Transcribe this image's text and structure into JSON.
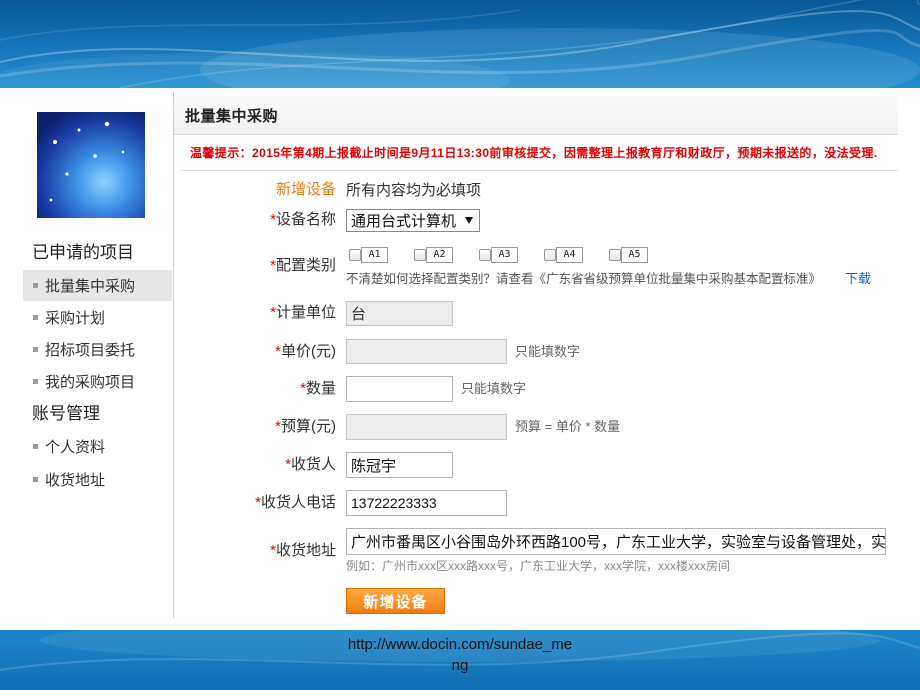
{
  "sidebar": {
    "active_index": 0,
    "sections": [
      {
        "title": "已申请的项目",
        "items": [
          "批量集中采购",
          "采购计划",
          "招标项目委托",
          "我的采购项目"
        ]
      },
      {
        "title": "账号管理",
        "items": [
          "个人资料",
          "收货地址"
        ]
      }
    ]
  },
  "main": {
    "title": "批量集中采购",
    "notice": "温馨提示：2015年第4期上报截止时间是9月11日13:30前审核提交，因需整理上报教育厅和财政厅，预期未报送的，没法受理.",
    "form": {
      "section_label": "新增设备",
      "required_note": "所有内容均为必填项",
      "required_mark": "*",
      "fields": {
        "device_name": {
          "label": "设备名称",
          "value": "通用台式计算机"
        },
        "config_category": {
          "label": "配置类别",
          "options": [
            "A1",
            "A2",
            "A3",
            "A4",
            "A5"
          ],
          "checked": [
            false,
            false,
            false,
            false,
            false
          ],
          "hint": "不清楚如何选择配置类别？请查看《广东省省级预算单位批量集中采购基本配置标准》",
          "download_link": "下载"
        },
        "unit": {
          "label": "计量单位",
          "value": "台",
          "disabled": true
        },
        "unit_price": {
          "label": "单价(元)",
          "value": "",
          "hint": "只能填数字",
          "disabled": true
        },
        "quantity": {
          "label": "数量",
          "value": "",
          "hint": "只能填数字"
        },
        "budget": {
          "label": "预算(元)",
          "value": "",
          "hint": "预算 = 单价 * 数量",
          "disabled": true
        },
        "receiver": {
          "label": "收货人",
          "value": "陈冠宇"
        },
        "receiver_phone": {
          "label": "收货人电话",
          "value": "13722223333"
        },
        "address": {
          "label": "收货地址",
          "value": "广州市番禺区小谷围岛外环西路100号，广东工业大学，实验室与设备管理处，实",
          "hint": "例如：广州市xxx区xxx路xxx号，广东工业大学，xxx学院，xxx楼xxx房间"
        }
      },
      "submit_label": "新增设备"
    }
  },
  "footer": {
    "watermark_line1": "http://www.docin.com/sundae_me",
    "watermark_line2": "ng"
  },
  "colors": {
    "banner_blue": "#1472b3",
    "notice_red": "#e60000",
    "label_orange": "#f07a10",
    "button_orange": "#f07d0e",
    "link_blue": "#1f5fb8",
    "active_item_bg": "#e6e6e6",
    "disabled_field_bg": "#ececec"
  },
  "icons": {
    "sidebar_bullet": "bullet-icon",
    "select_arrow": "chevron-down-icon",
    "checkbox": "checkbox-icon"
  }
}
